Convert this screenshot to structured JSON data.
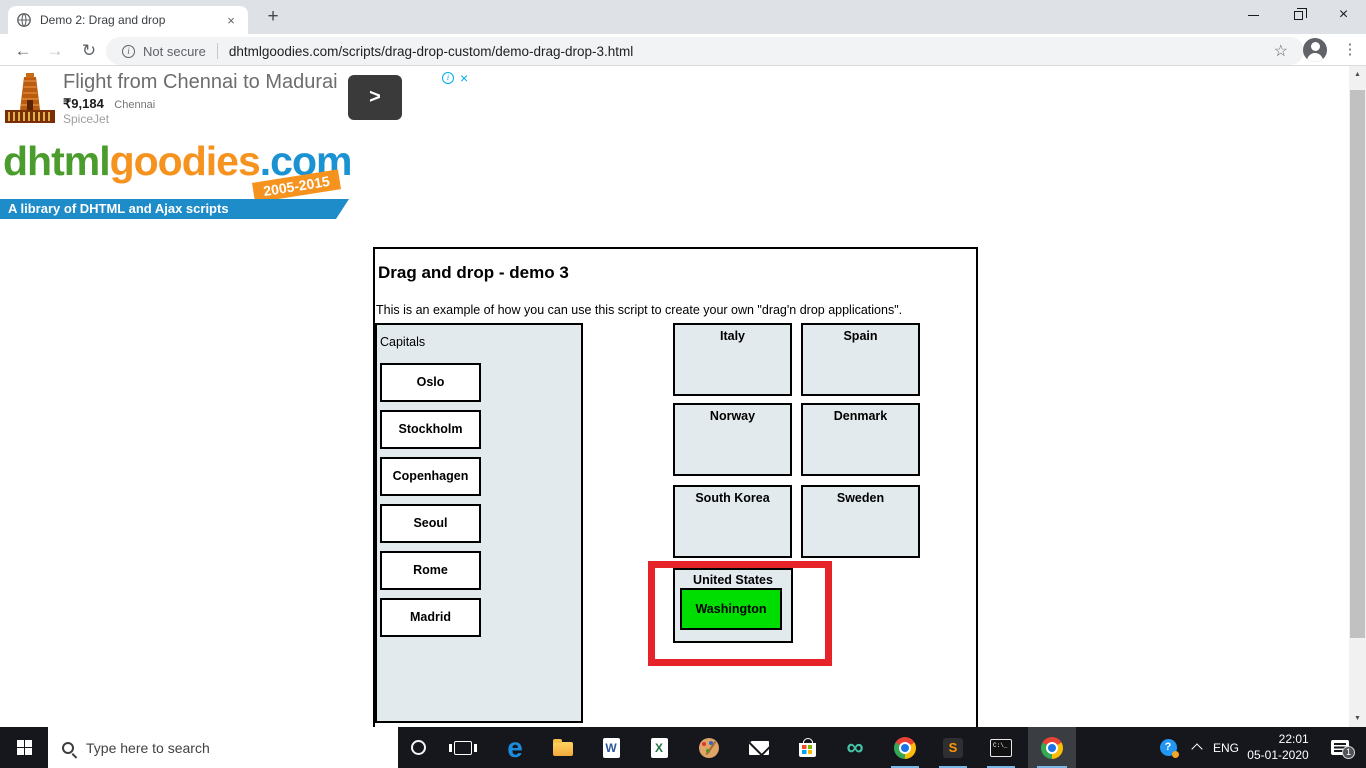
{
  "browser": {
    "tab_title": "Demo 2: Drag and drop",
    "security_label": "Not secure",
    "url": "dhtmlgoodies.com/scripts/drag-drop-custom/demo-drag-drop-3.html"
  },
  "ad": {
    "headline": "Flight from Chennai to Madurai",
    "price": "₹9,184",
    "subtitle": "Chennai",
    "advertiser": "SpiceJet"
  },
  "logo": {
    "word1": "dhtml",
    "word2": "goodies",
    "word3": ".com",
    "badge": "2005-2015",
    "tagline": "A library of DHTML and Ajax scripts",
    "colors": {
      "green": "#4a9c2d",
      "orange": "#f6921e",
      "blue": "#1b92d1",
      "bar": "#1e8cc8"
    }
  },
  "demo": {
    "title": "Drag and drop - demo 3",
    "description": "This is an example of how you can use this script to create your own \"drag'n drop applications\".",
    "capitals_label": "Capitals",
    "capitals": [
      "Oslo",
      "Stockholm",
      "Copenhagen",
      "Seoul",
      "Rome",
      "Madrid"
    ],
    "countries": [
      "Italy",
      "Spain",
      "Norway",
      "Denmark",
      "South Korea",
      "Sweden"
    ],
    "dropped": {
      "country": "United States",
      "capital": "Washington"
    },
    "colors": {
      "panel": "#e2eaee",
      "dropped_capital": "#00dd00",
      "highlight_border": "#e62329"
    }
  },
  "taskbar": {
    "search_placeholder": "Type here to search",
    "apps": [
      "start",
      "cortana",
      "task-view",
      "edge",
      "file-explorer",
      "word",
      "excel",
      "paint",
      "mail",
      "store",
      "infinity-app",
      "chrome",
      "sublime-text",
      "command-prompt",
      "chrome-active"
    ],
    "language": "ENG",
    "time": "22:01",
    "date": "05-01-2020",
    "notification_count": "1"
  },
  "icons": {
    "close": "×",
    "new_tab": "+",
    "back": "←",
    "forward": "→",
    "reload": "↻",
    "star": "☆",
    "menu": "⋮",
    "info": "i",
    "ad_arrow": ">",
    "infinity": "∞",
    "edge": "e",
    "word": "W",
    "excel": "X",
    "sublime": "S",
    "cmd": "C:\\_",
    "question": "?",
    "scroll_up": "▲",
    "scroll_down": "▼"
  }
}
